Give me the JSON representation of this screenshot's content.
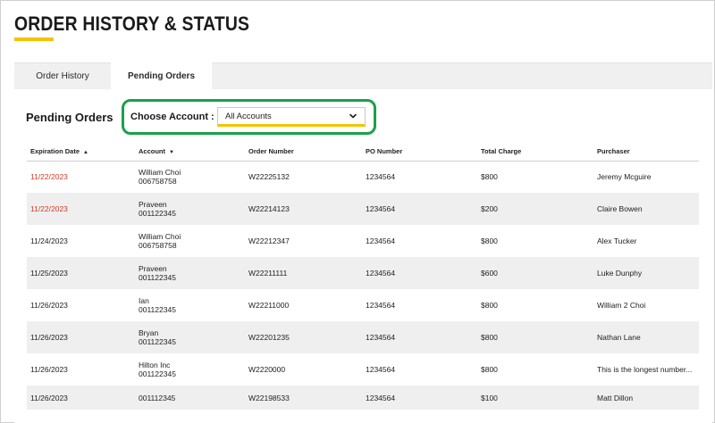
{
  "page": {
    "title": "ORDER HISTORY & STATUS",
    "accent_color": "#f5c400",
    "highlight_color": "#1aa04a"
  },
  "tabs": [
    {
      "label": "Order History",
      "active": false
    },
    {
      "label": "Pending Orders",
      "active": true
    }
  ],
  "section": {
    "title": "Pending Orders",
    "account_label": "Choose Account :",
    "account_select": {
      "value": "All Accounts",
      "icon": "chevron-down-icon"
    }
  },
  "table": {
    "headers": {
      "expiration": "Expiration Date",
      "expiration_sort": "▲",
      "account": "Account",
      "account_sort": "▼",
      "order_number": "Order Number",
      "po_number": "PO Number",
      "total_charge": "Total Charge",
      "purchaser": "Purchaser"
    },
    "rows": [
      {
        "expiration": "11/22/2023",
        "expired": true,
        "account_name": "William Choi",
        "account_id": "006758758",
        "order": "W22225132",
        "po": "1234564",
        "total": "$800",
        "purchaser": "Jeremy Mcguire"
      },
      {
        "expiration": "11/22/2023",
        "expired": true,
        "account_name": "Praveen",
        "account_id": "001122345",
        "order": "W22214123",
        "po": "1234564",
        "total": "$200",
        "purchaser": "Claire Bowen"
      },
      {
        "expiration": "11/24/2023",
        "expired": false,
        "account_name": "William Choi",
        "account_id": "006758758",
        "order": "W22212347",
        "po": "1234564",
        "total": "$800",
        "purchaser": "Alex Tucker"
      },
      {
        "expiration": "11/25/2023",
        "expired": false,
        "account_name": "Praveen",
        "account_id": "001122345",
        "order": "W22211111",
        "po": "1234564",
        "total": "$600",
        "purchaser": "Luke Dunphy"
      },
      {
        "expiration": "11/26/2023",
        "expired": false,
        "account_name": "Ian",
        "account_id": "001122345",
        "order": "W22211000",
        "po": "1234564",
        "total": "$800",
        "purchaser": "William 2 Choi"
      },
      {
        "expiration": "11/26/2023",
        "expired": false,
        "account_name": "Bryan",
        "account_id": "001122345",
        "order": "W22201235",
        "po": "1234564",
        "total": "$800",
        "purchaser": "Nathan Lane"
      },
      {
        "expiration": "11/26/2023",
        "expired": false,
        "account_name": "Hilton Inc",
        "account_id": "001122345",
        "order": "W2220000",
        "po": "1234564",
        "total": "$800",
        "purchaser": "This is the longest number..."
      },
      {
        "expiration": "11/26/2023",
        "expired": false,
        "account_name": "",
        "account_id": "001112345",
        "order": "W22198533",
        "po": "1234564",
        "total": "$100",
        "purchaser": "Matt Dillon"
      }
    ]
  }
}
